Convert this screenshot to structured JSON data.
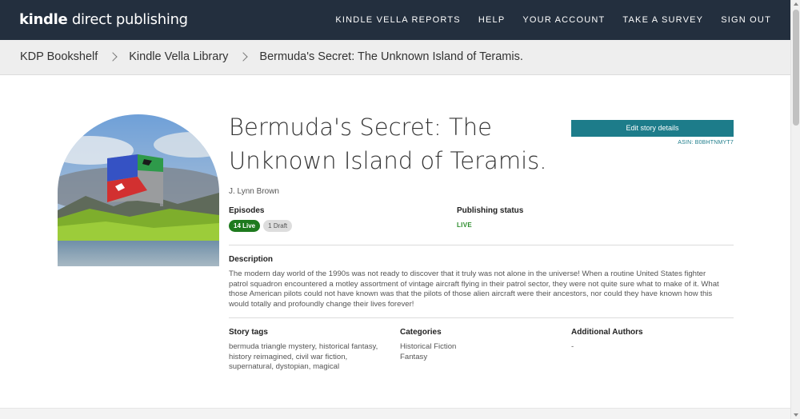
{
  "header": {
    "logo_bold": "kindle",
    "logo_light": " direct publishing",
    "nav": [
      "KINDLE VELLA REPORTS",
      "HELP",
      "YOUR ACCOUNT",
      "TAKE A SURVEY",
      "SIGN OUT"
    ]
  },
  "breadcrumb": [
    "KDP Bookshelf",
    "Kindle Vella Library",
    "Bermuda's Secret: The Unknown Island of Teramis."
  ],
  "story": {
    "title": "Bermuda's Secret: The Unknown Island of Teramis.",
    "author": "J. Lynn Brown",
    "edit_label": "Edit story details",
    "asin": "ASIN: B0BHTNMYT7",
    "episodes_label": "Episodes",
    "live_badge": "14 Live",
    "draft_badge": "1 Draft",
    "publishing_status_label": "Publishing status",
    "publishing_status_value": "LIVE",
    "description_label": "Description",
    "description": "The modern day world of the 1990s was not ready to discover that it truly was not alone in the universe! When a routine United States fighter patrol squadron encountered a motley assortment of vintage aircraft flying in their patrol sector, they were not quite sure what to make of it. What those American pilots could not have known was that the pilots of those alien aircraft were their ancestors, nor could they have known how this would totally and profoundly change their lives forever!",
    "tags_label": "Story tags",
    "tags": "bermuda triangle mystery, historical fantasy, history reimagined, civil war fiction, supernatural, dystopian, magical",
    "categories_label": "Categories",
    "categories": [
      "Historical Fiction",
      "Fantasy"
    ],
    "additional_authors_label": "Additional Authors",
    "additional_authors": "-"
  },
  "colors": {
    "header_bg": "#232f3e",
    "accent": "#1d7c8a",
    "live_green": "#1e7a1e",
    "status_green": "#2c8c2c"
  }
}
